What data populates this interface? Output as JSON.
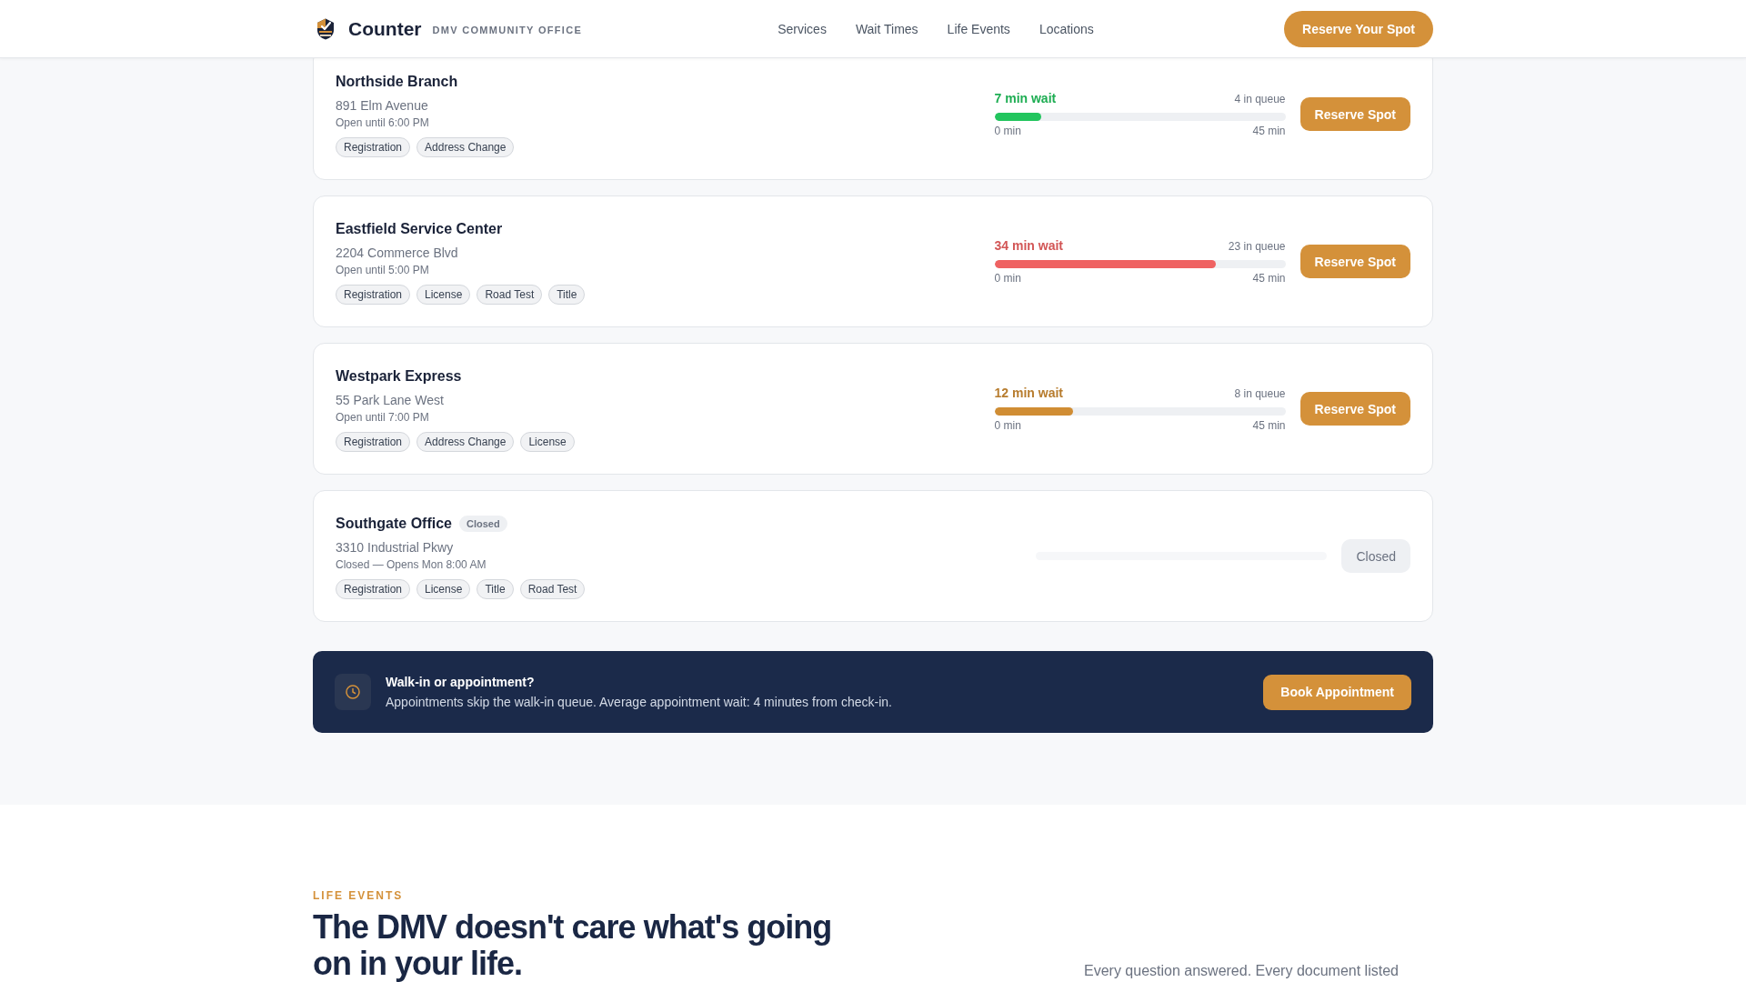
{
  "header": {
    "brand": "Counter",
    "tagline": "DMV COMMUNITY OFFICE",
    "nav": [
      "Services",
      "Wait Times",
      "Life Events",
      "Locations"
    ],
    "cta": "Reserve Your Spot"
  },
  "branches": [
    {
      "name": "Northside Branch",
      "closed": false,
      "address": "891 Elm Avenue",
      "hours": "Open until 6:00 PM",
      "services": [
        "Registration",
        "Address Change"
      ],
      "wait": {
        "text": "7 min wait",
        "queue": "4 in queue",
        "level": 0.16,
        "color": "#22c55e",
        "min_label": "0 min",
        "max_label": "45 min"
      },
      "action": {
        "label": "Reserve Spot",
        "disabled": false
      }
    },
    {
      "name": "Eastfield Service Center",
      "closed": false,
      "address": "2204 Commerce Blvd",
      "hours": "Open until 5:00 PM",
      "services": [
        "Registration",
        "License",
        "Road Test",
        "Title"
      ],
      "wait": {
        "text": "34 min wait",
        "queue": "23 in queue",
        "level": 0.76,
        "color": "#ef6262",
        "min_label": "0 min",
        "max_label": "45 min"
      },
      "action": {
        "label": "Reserve Spot",
        "disabled": false
      }
    },
    {
      "name": "Westpark Express",
      "closed": false,
      "address": "55 Park Lane West",
      "hours": "Open until 7:00 PM",
      "services": [
        "Registration",
        "Address Change",
        "License"
      ],
      "wait": {
        "text": "12 min wait",
        "queue": "8 in queue",
        "level": 0.27,
        "color": "#d08d34",
        "min_label": "0 min",
        "max_label": "45 min"
      },
      "action": {
        "label": "Reserve Spot",
        "disabled": false
      }
    },
    {
      "name": "Southgate Office",
      "closed": true,
      "badge": "Closed",
      "address": "3310 Industrial Pkwy",
      "hours": "Closed — Opens Mon 8:00 AM",
      "services": [
        "Registration",
        "License",
        "Title",
        "Road Test"
      ],
      "action": {
        "label": "Closed",
        "disabled": true
      }
    }
  ],
  "notice": {
    "title": "Walk-in or appointment?",
    "text": "Appointments skip the walk-in queue. Average appointment wait: 4 minutes from check-in.",
    "button": "Book Appointment"
  },
  "life_events": {
    "eyebrow": "LIFE EVENTS",
    "heading": "The DMV doesn't care what's going on in your life.",
    "text": "Every question answered. Every document listed"
  }
}
